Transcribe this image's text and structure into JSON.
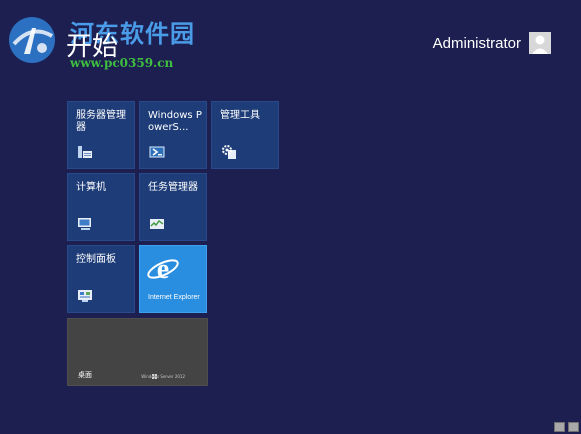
{
  "watermark": {
    "title": "河东软件园",
    "url": "www.pc0359.cn"
  },
  "start_title": "开始",
  "user": {
    "name": "Administrator",
    "avatar_icon": "user-avatar-icon"
  },
  "tiles": [
    {
      "label": "服务器管理器",
      "icon": "server-manager-icon"
    },
    {
      "label": "Windows PowerS...",
      "icon": "powershell-icon"
    },
    {
      "label": "管理工具",
      "icon": "admin-tools-icon"
    },
    {
      "label": "计算机",
      "icon": "computer-icon"
    },
    {
      "label": "任务管理器",
      "icon": "task-manager-icon"
    },
    {
      "label": "控制面板",
      "icon": "control-panel-icon"
    },
    {
      "label": "Internet Explorer",
      "icon": "ie-icon"
    },
    {
      "label": "桌面",
      "icon": "desktop-icon",
      "brand": "Windows Server 2012"
    }
  ],
  "colors": {
    "background": "#1c1f4f",
    "tile": "#1d3c78",
    "ie_tile": "#2a8ee0",
    "desktop_tile": "#444444",
    "watermark_title": "#4a9be8",
    "watermark_url": "#3fbf3f"
  }
}
